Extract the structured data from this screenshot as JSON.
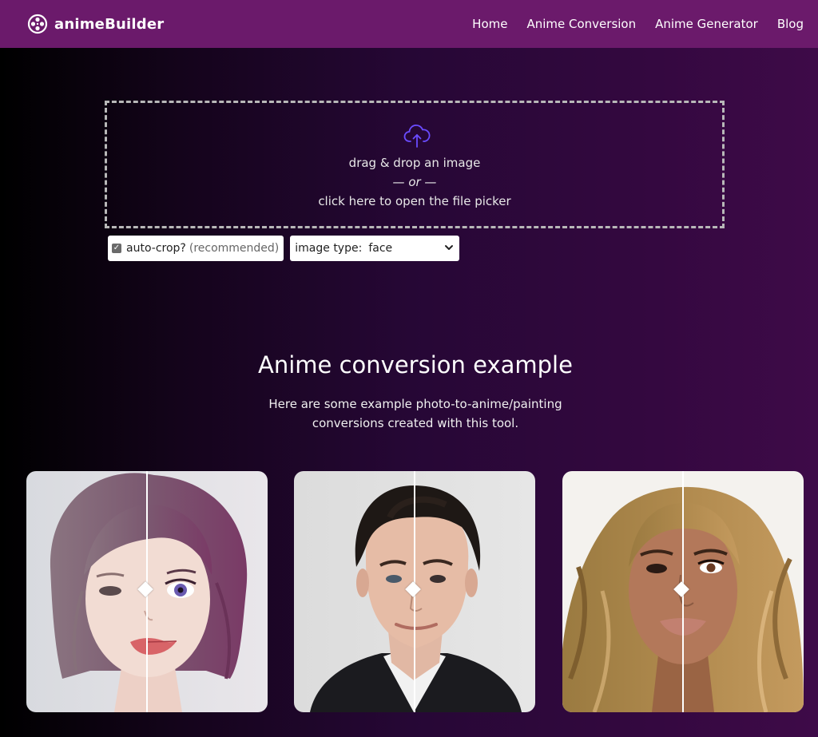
{
  "header": {
    "brand": "animeBuilder",
    "nav": [
      "Home",
      "Anime Conversion",
      "Anime Generator",
      "Blog"
    ]
  },
  "dropzone": {
    "line1": "drag & drop an image",
    "line2": "— or —",
    "line3": "click here to open the file picker"
  },
  "options": {
    "autocrop_label": "auto-crop?",
    "autocrop_hint": "(recommended)",
    "autocrop_checked": true,
    "image_type_label": "image type:",
    "image_type_value": "face"
  },
  "section": {
    "title": "Anime conversion example",
    "description": "Here are some example photo-to-anime/painting conversions created with this tool."
  },
  "examples": [
    {
      "icon": "woman-portrait-comparison"
    },
    {
      "icon": "man-portrait-comparison"
    },
    {
      "icon": "woman-curly-hair-portrait-comparison"
    }
  ],
  "colors": {
    "header_bg": "#6b1a6b",
    "upload_icon": "#6a4cff",
    "dropzone_border": "#b8b8b8"
  }
}
